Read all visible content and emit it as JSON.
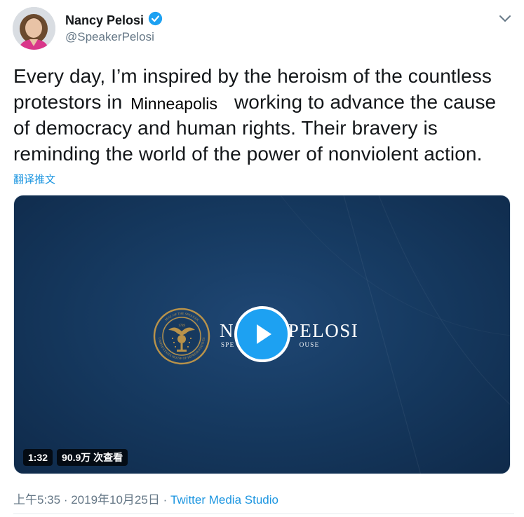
{
  "author": {
    "display_name": "Nancy Pelosi",
    "handle": "@SpeakerPelosi",
    "verified": true
  },
  "tweet": {
    "text_part1": "Every day, I’m inspired by the heroism of the countless protestors in ",
    "highlight": "Minneapolis",
    "text_part2": " working to advance the cause of democracy and human rights. Their bravery is reminding the world of the power of nonviolent action.",
    "translate_label": "翻译推文"
  },
  "media": {
    "brand_name": "N      Y PELOSI",
    "brand_sub": "SPE                          OUSE",
    "seal_top_text": "SEAL OF THE SPEAKER",
    "seal_bottom_text": "UNITED STATES HOUSE OF REPRESENTATIVES",
    "seal_year": "1789",
    "duration": "1:32",
    "views": "90.9万 次查看"
  },
  "meta": {
    "time": "上午5:35",
    "date": "2019年10月25日",
    "separator": " · ",
    "source": "Twitter Media Studio"
  },
  "icons": {
    "verified": "verified-badge-icon",
    "caret": "chevron-down-icon",
    "play": "play-icon"
  },
  "colors": {
    "accent": "#1da1f2",
    "link": "#1b95e0",
    "secondary_text": "#657786",
    "video_bg": "#163a61",
    "seal_gold": "#b8924a"
  }
}
